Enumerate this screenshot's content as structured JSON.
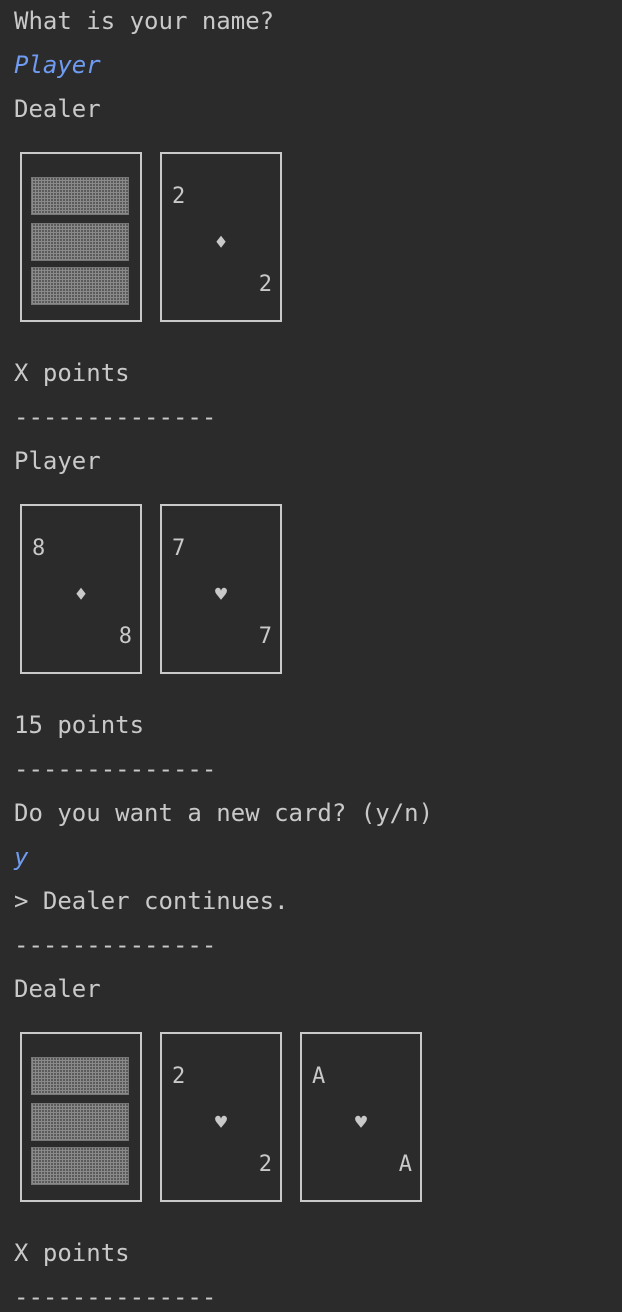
{
  "console": {
    "prompt_name": "What is your name?",
    "input_name": "Player",
    "dealer_label_1": "Dealer",
    "dealer_points_1": "X points",
    "separator": "--------------",
    "player_label": "Player",
    "player_points": "15 points",
    "prompt_new_card": "Do you want a new card? (y/n)",
    "input_answer": "y",
    "dealer_continues": "> Dealer continues.",
    "dealer_label_2": "Dealer",
    "dealer_points_2": "X points"
  },
  "hands": {
    "dealer_1": [
      {
        "hidden": true
      },
      {
        "rank": "2",
        "suit": "♦",
        "suit_name": "diamond-icon"
      }
    ],
    "player": [
      {
        "rank": "8",
        "suit": "♦",
        "suit_name": "diamond-icon"
      },
      {
        "rank": "7",
        "suit": "♥",
        "suit_name": "heart-icon"
      }
    ],
    "dealer_2": [
      {
        "hidden": true
      },
      {
        "rank": "2",
        "suit": "♥",
        "suit_name": "heart-icon"
      },
      {
        "rank": "A",
        "suit": "♥",
        "suit_name": "heart-icon"
      }
    ]
  },
  "colors": {
    "background": "#2b2b2b",
    "text": "#c9c9c9",
    "user_input": "#6f9cf2"
  }
}
